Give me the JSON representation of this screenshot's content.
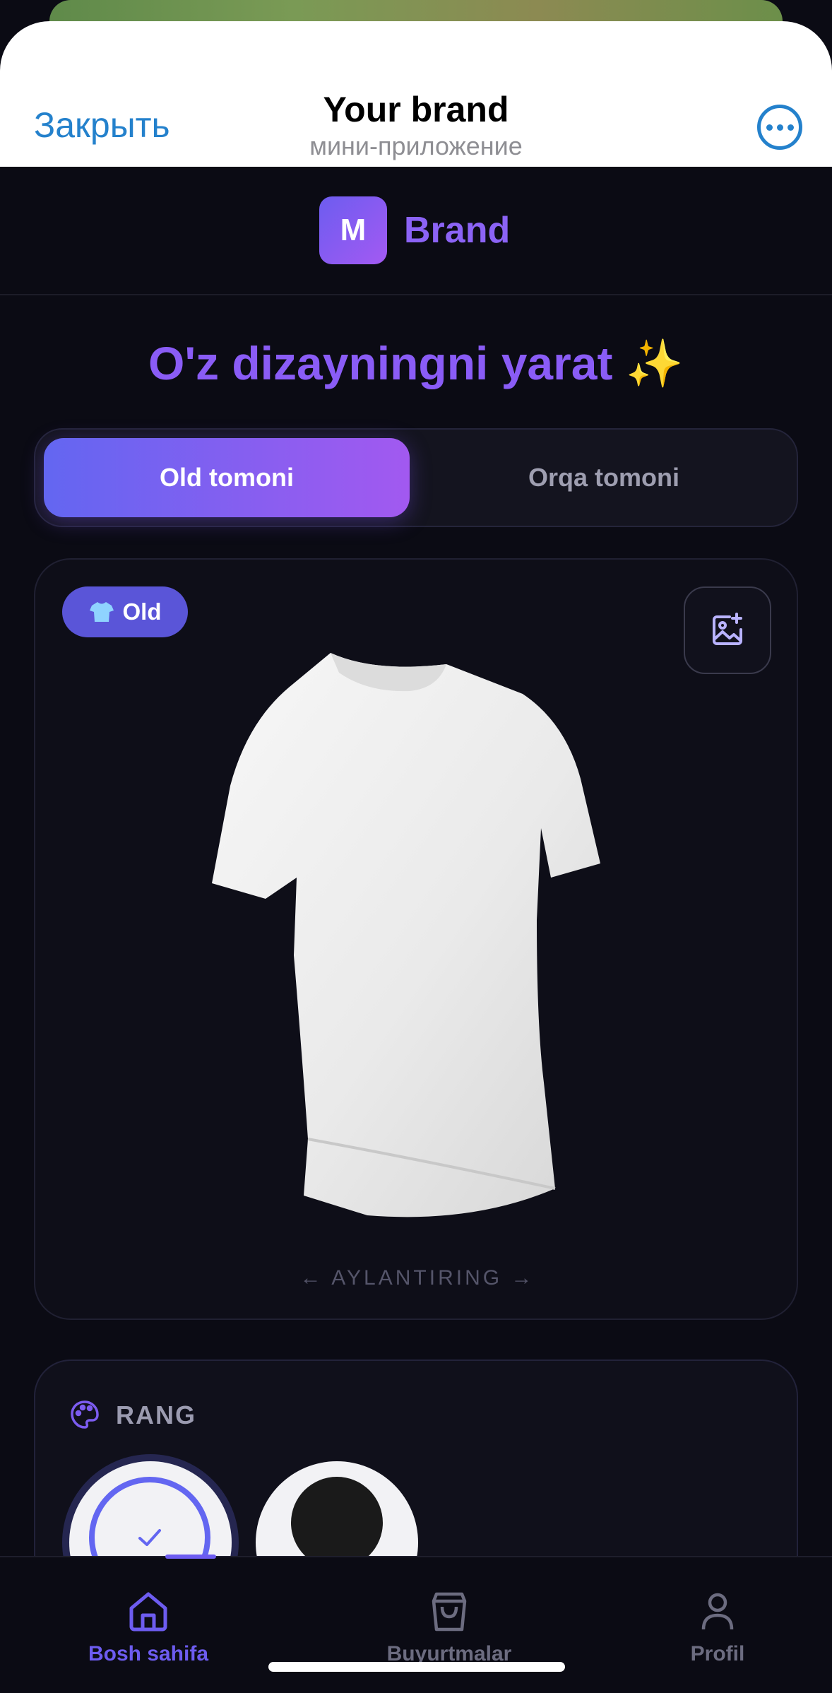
{
  "telegram": {
    "close_label": "Закрыть",
    "title": "Your brand",
    "subtitle": "мини-приложение",
    "more_icon": "more-horizontal-icon"
  },
  "brand": {
    "logo_letter": "M",
    "name": "Brand",
    "accent": "#8b63f5"
  },
  "headline": "O'z dizayningni yarat ✨",
  "tabs": [
    {
      "label": "Old tomoni",
      "active": true
    },
    {
      "label": "Orqa tomoni",
      "active": false
    }
  ],
  "preview": {
    "side_badge": "Old",
    "badge_icon": "tshirt-icon",
    "add_image_icon": "add-image-icon",
    "rotate_hint": "← AYLANTIRING →"
  },
  "color_section": {
    "title": "RANG",
    "icon": "palette-icon",
    "swatches": [
      {
        "name": "white",
        "color": "#f2f2f5",
        "selected": true
      },
      {
        "name": "black",
        "color": "#1a1a1a",
        "selected": false
      }
    ]
  },
  "nav": [
    {
      "label": "Bosh sahifa",
      "icon": "home-icon",
      "active": true
    },
    {
      "label": "Buyurtmalar",
      "icon": "shopping-bag-icon",
      "active": false
    },
    {
      "label": "Profil",
      "icon": "user-icon",
      "active": false
    }
  ],
  "colors": {
    "accent": "#6d5cf0",
    "background": "#0b0b14",
    "telegram_blue": "#2481cc"
  }
}
